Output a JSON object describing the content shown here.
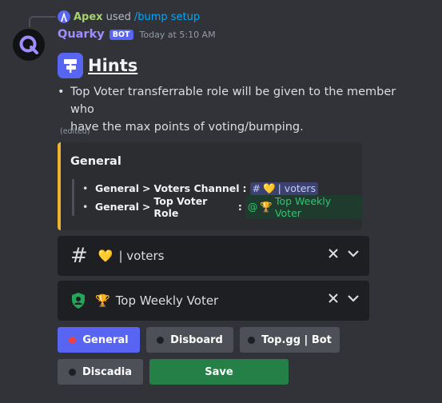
{
  "reply": {
    "user": "Apex",
    "action": "used",
    "command": "/bump setup"
  },
  "message": {
    "username": "Quarky",
    "bot_badge": "BOT",
    "timestamp": "Today at 5:10 AM",
    "hints_title": "Hints",
    "bullet_line1": "Top Voter transferrable role will be given to the member who",
    "bullet_line2": "have the max points of voting/bumping.",
    "edited": "(edited)"
  },
  "embed": {
    "title": "General",
    "items": [
      {
        "label": "General",
        "sep": " > ",
        "key": "Voters Channel",
        "colon": " : ",
        "mention_prefix": "#",
        "mention_emoji": "💛",
        "mention_text": "| voters"
      },
      {
        "label": "General",
        "sep": " > ",
        "key": "Top Voter Role",
        "colon": " : ",
        "mention_prefix": "@",
        "mention_emoji": "🏆",
        "mention_text": "Top Weekly Voter"
      }
    ],
    "accent_color": "#f0b232"
  },
  "selects": {
    "channel": {
      "prefix": "#",
      "emoji": "💛",
      "text": "| voters"
    },
    "role": {
      "emoji": "🏆",
      "text": "Top Weekly Voter"
    }
  },
  "buttons": {
    "general": "General",
    "disboard": "Disboard",
    "topgg": "Top.gg | Bot",
    "discadia": "Discadia",
    "save": "Save"
  },
  "colors": {
    "blurple": "#5865f2",
    "green": "#248046",
    "active_dot": "#ed4245"
  }
}
